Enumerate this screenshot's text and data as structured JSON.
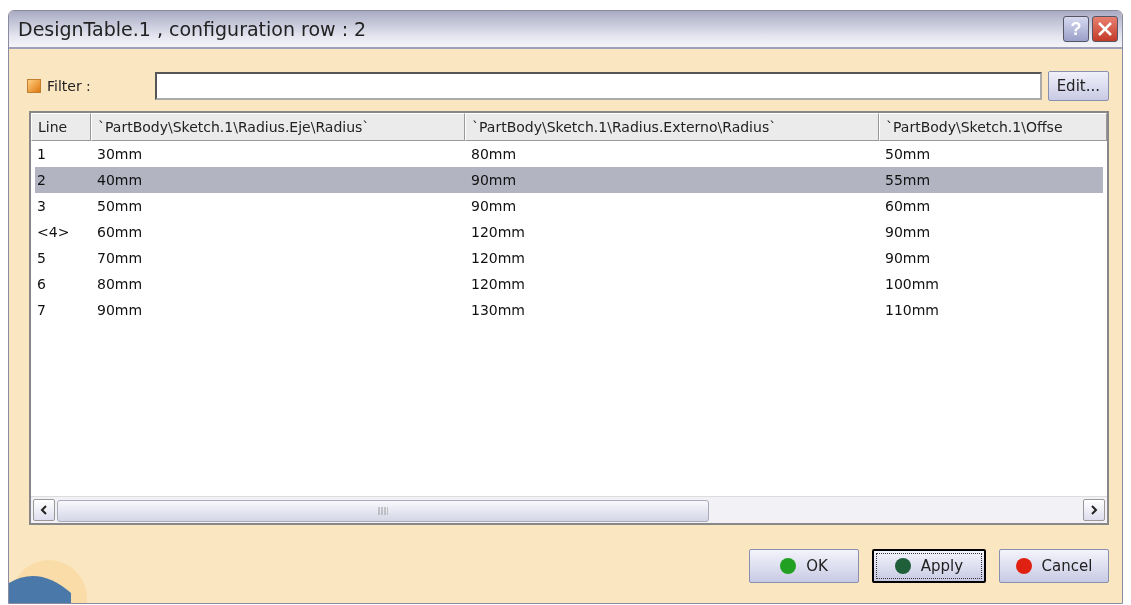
{
  "window": {
    "title": "DesignTable.1 , configuration row : 2",
    "title_buttons": [
      "?"
    ]
  },
  "filter": {
    "label": "Filter :",
    "checked": true,
    "button": "Edit..."
  },
  "table": {
    "columns": [
      "Line",
      "`PartBody\\Sketch.1\\Radius.Eje\\Radius`",
      "`PartBody\\Sketch.1\\Radius.Externo\\Radius`",
      "`PartBody\\Sketch.1\\Offse"
    ],
    "rows": [
      {
        "cells": [
          "1",
          "30mm",
          "80mm",
          "50mm"
        ],
        "selected": false
      },
      {
        "cells": [
          "2",
          "40mm",
          "90mm",
          "55mm"
        ],
        "selected": true
      },
      {
        "cells": [
          "3",
          "50mm",
          "90mm",
          "60mm"
        ],
        "selected": false
      },
      {
        "cells": [
          "<4>",
          "60mm",
          "120mm",
          "90mm"
        ],
        "selected": false
      },
      {
        "cells": [
          "5",
          "70mm",
          "120mm",
          "90mm"
        ],
        "selected": false
      },
      {
        "cells": [
          "6",
          "80mm",
          "120mm",
          "100mm"
        ],
        "selected": false
      },
      {
        "cells": [
          "7",
          "90mm",
          "130mm",
          "110mm"
        ],
        "selected": false
      }
    ]
  },
  "buttons": [
    {
      "label": "OK",
      "color": "#22a022",
      "focused": false
    },
    {
      "label": "Apply",
      "color": "#1f5f3a",
      "focused": true
    },
    {
      "label": "Cancel",
      "color": "#e02010",
      "focused": false
    }
  ]
}
